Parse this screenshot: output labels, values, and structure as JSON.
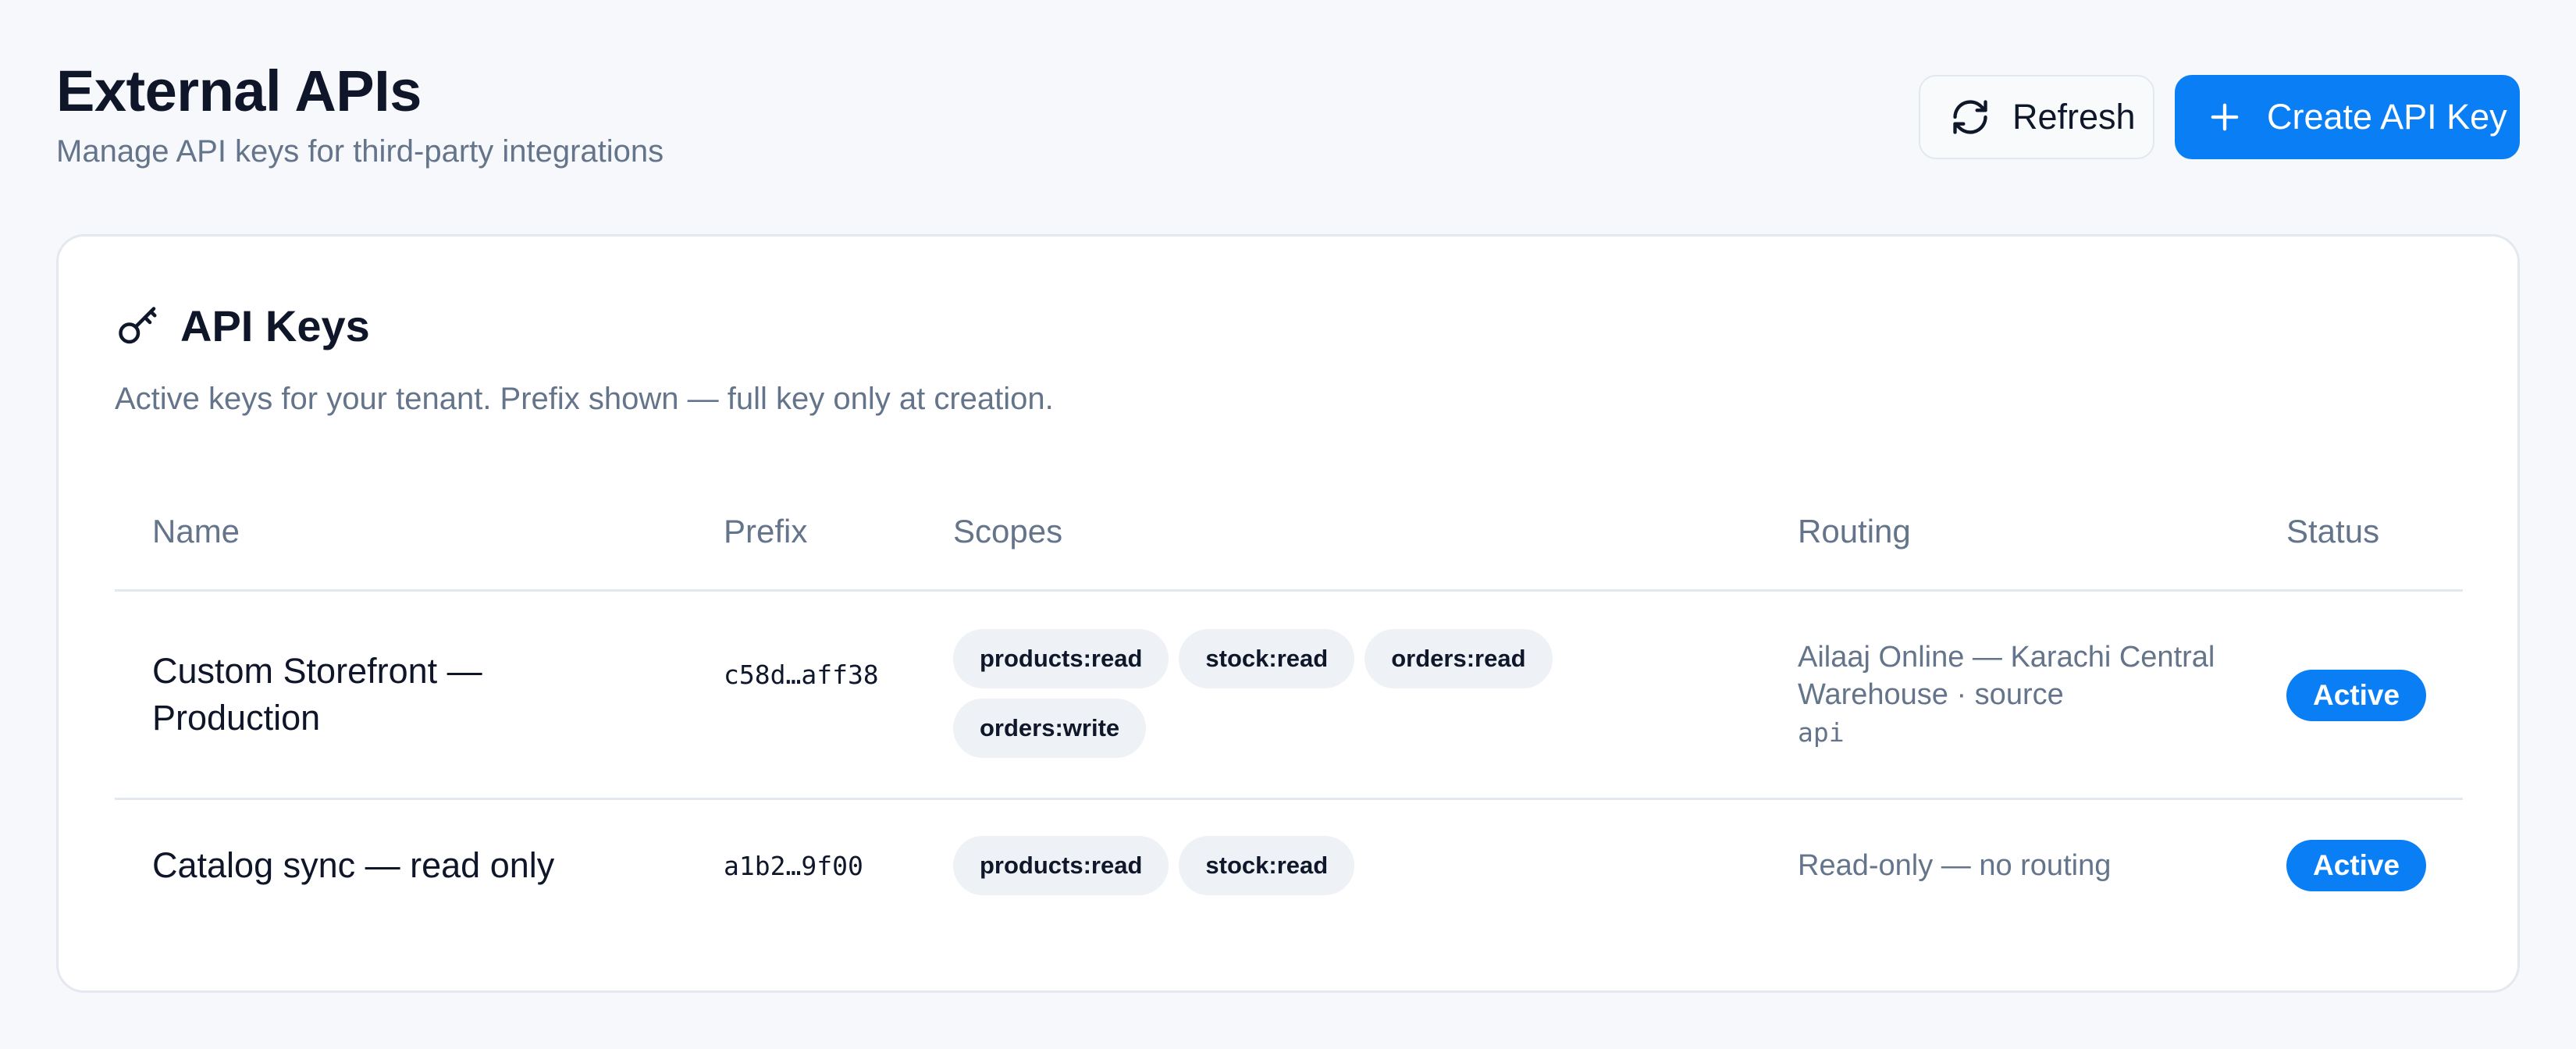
{
  "header": {
    "title": "External APIs",
    "subtitle": "Manage API keys for third-party integrations"
  },
  "actions": {
    "refresh_label": "Refresh",
    "refresh_icon": "refresh-icon",
    "create_label": "Create API Key",
    "create_icon": "plus-icon"
  },
  "colors": {
    "accent": "#0a7ff5",
    "background": "#f7f8fb",
    "muted_text": "#64748b"
  },
  "card": {
    "icon": "key-icon",
    "title": "API Keys",
    "description": "Active keys for your tenant. Prefix shown — full key only at creation."
  },
  "table": {
    "columns": [
      "Name",
      "Prefix",
      "Scopes",
      "Routing",
      "Status"
    ],
    "rows": [
      {
        "name": "Custom Storefront — Production",
        "prefix": "c58d…aff38",
        "scopes": [
          "products:read",
          "stock:read",
          "orders:read",
          "orders:write"
        ],
        "routing": "Ailaaj Online — Karachi Central Warehouse · source",
        "routing_source": "api",
        "status": "Active"
      },
      {
        "name": "Catalog sync — read only",
        "prefix": "a1b2…9f00",
        "scopes": [
          "products:read",
          "stock:read"
        ],
        "routing": "Read-only — no routing",
        "routing_source": "",
        "status": "Active"
      }
    ]
  }
}
